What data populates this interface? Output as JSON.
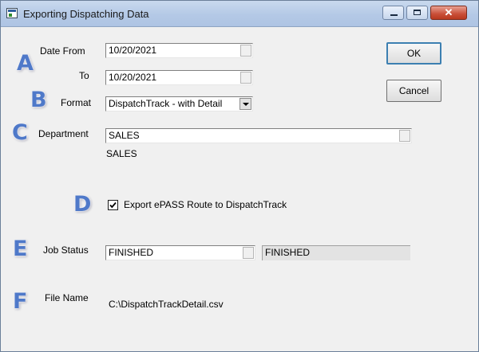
{
  "window": {
    "title": "Exporting Dispatching Data"
  },
  "titlebar_buttons": {
    "minimize_icon": "minimize-icon",
    "maximize_icon": "maximize-icon",
    "close_glyph": "✕"
  },
  "annotations": [
    "A",
    "B",
    "C",
    "D",
    "E",
    "F"
  ],
  "date_from": {
    "label": "Date  From",
    "value": "10/20/2021"
  },
  "date_to": {
    "label": "To",
    "value": "10/20/2021"
  },
  "format": {
    "label": "Format",
    "value": "DispatchTrack - with Detail"
  },
  "department": {
    "label": "Department",
    "value": "SALES",
    "description": "SALES"
  },
  "export_epass": {
    "label": "Export ePASS Route to DispatchTrack",
    "checked": true
  },
  "job_status": {
    "label": "Job Status",
    "value": "FINISHED",
    "description": "FINISHED"
  },
  "file_name": {
    "label": "File Name",
    "value": "C:\\DispatchTrackDetail.csv"
  },
  "buttons": {
    "ok": "OK",
    "cancel": "Cancel"
  },
  "colors": {
    "annotation_letter": "#4f79c9",
    "titlebar": "#b4c9e6",
    "close_button": "#c94f38",
    "ok_focus": "#3c7fb1"
  }
}
